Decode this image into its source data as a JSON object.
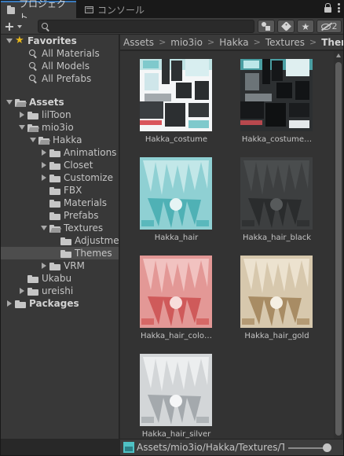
{
  "tabs": [
    {
      "label": "プロジェクト",
      "icon": "folder-icon"
    },
    {
      "label": "コンソール",
      "icon": "console-icon"
    }
  ],
  "toolbar": {
    "add_label": "+",
    "search_value": "",
    "hidden_count": "2"
  },
  "sidebar": {
    "favorites": {
      "label": "Favorites",
      "items": [
        "All Materials",
        "All Models",
        "All Prefabs"
      ]
    },
    "assets_label": "Assets",
    "tree": {
      "liltoon": "lilToon",
      "mio3io": "mio3io",
      "hakka": "Hakka",
      "animations": "Animations",
      "closet": "Closet",
      "customize": "Customize",
      "fbx": "FBX",
      "materials": "Materials",
      "prefabs": "Prefabs",
      "textures": "Textures",
      "adjustments": "Adjustme",
      "themes": "Themes",
      "vrm": "VRM",
      "ukabu": "Ukabu",
      "ureishi": "ureishi"
    },
    "packages_label": "Packages"
  },
  "breadcrumb": [
    "Assets",
    "mio3io",
    "Hakka",
    "Textures",
    "Themes"
  ],
  "grid": {
    "items": [
      {
        "label": "Hakka_costume",
        "theme": "costume-light"
      },
      {
        "label": "Hakka_costume…",
        "theme": "costume-dark"
      },
      {
        "label": "Hakka_hair",
        "theme": "hair-cyan"
      },
      {
        "label": "Hakka_hair_black",
        "theme": "hair-black"
      },
      {
        "label": "Hakka_hair_colo…",
        "theme": "hair-red"
      },
      {
        "label": "Hakka_hair_gold",
        "theme": "hair-gold"
      },
      {
        "label": "Hakka_hair_silver",
        "theme": "hair-silver"
      }
    ]
  },
  "footer": {
    "path": "Assets/mio3io/Hakka/Textures/T"
  },
  "colors": {
    "accent": "#3a79bb",
    "favorite_star": "#e8b71a",
    "hair_cyan": "#5fb6ba",
    "hair_black": "#3a3a3a",
    "hair_red": "#dc7a78",
    "hair_gold": "#d2c2a6",
    "hair_silver": "#c8ccce"
  }
}
